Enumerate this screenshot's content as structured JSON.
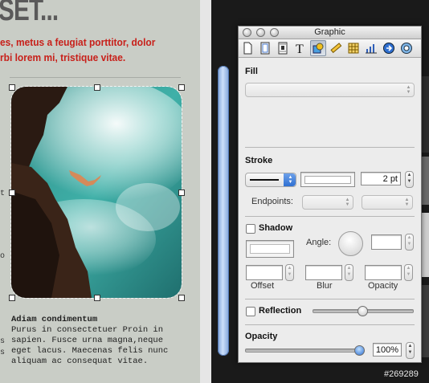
{
  "document": {
    "heading": "SET...",
    "red_line_1": "es, metus a feugiat porttitor, dolor",
    "red_line_2": "rbi lorem mi, tristique vitae.",
    "caption_title": "Adiam condimentum",
    "caption_lines": [
      "Purus in consectetuer Proin in",
      "sapien. Fusce urna magna,neque",
      "eget lacus. Maecenas felis nunc",
      "aliquam ac consequat vitae."
    ],
    "margin_chars": [
      "t",
      "o",
      "s",
      "s"
    ],
    "photo_description": "cliff diver photo"
  },
  "inspector": {
    "title": "Graphic",
    "toolbar_icons": [
      "document-icon",
      "layout-icon",
      "wrap-icon",
      "text-icon",
      "graphic-icon",
      "metrics-icon",
      "table-icon",
      "chart-icon",
      "link-icon",
      "quicktime-icon"
    ],
    "active_tab": "graphic-icon",
    "fill": {
      "label": "Fill",
      "value": ""
    },
    "stroke": {
      "label": "Stroke",
      "width": "2 pt",
      "endpoints_label": "Endpoints:"
    },
    "shadow": {
      "label": "Shadow",
      "checked": false,
      "angle_label": "Angle:",
      "offset_label": "Offset",
      "blur_label": "Blur",
      "opacity_label": "Opacity"
    },
    "reflection": {
      "label": "Reflection",
      "checked": false,
      "level": 0.5
    },
    "opacity": {
      "label": "Opacity",
      "value": "100%",
      "level": 1.0
    },
    "colors": {
      "accent": "#2e6fd2",
      "stroke_swatch": "#ffffff"
    }
  },
  "background": {
    "image_id": "#269289"
  }
}
